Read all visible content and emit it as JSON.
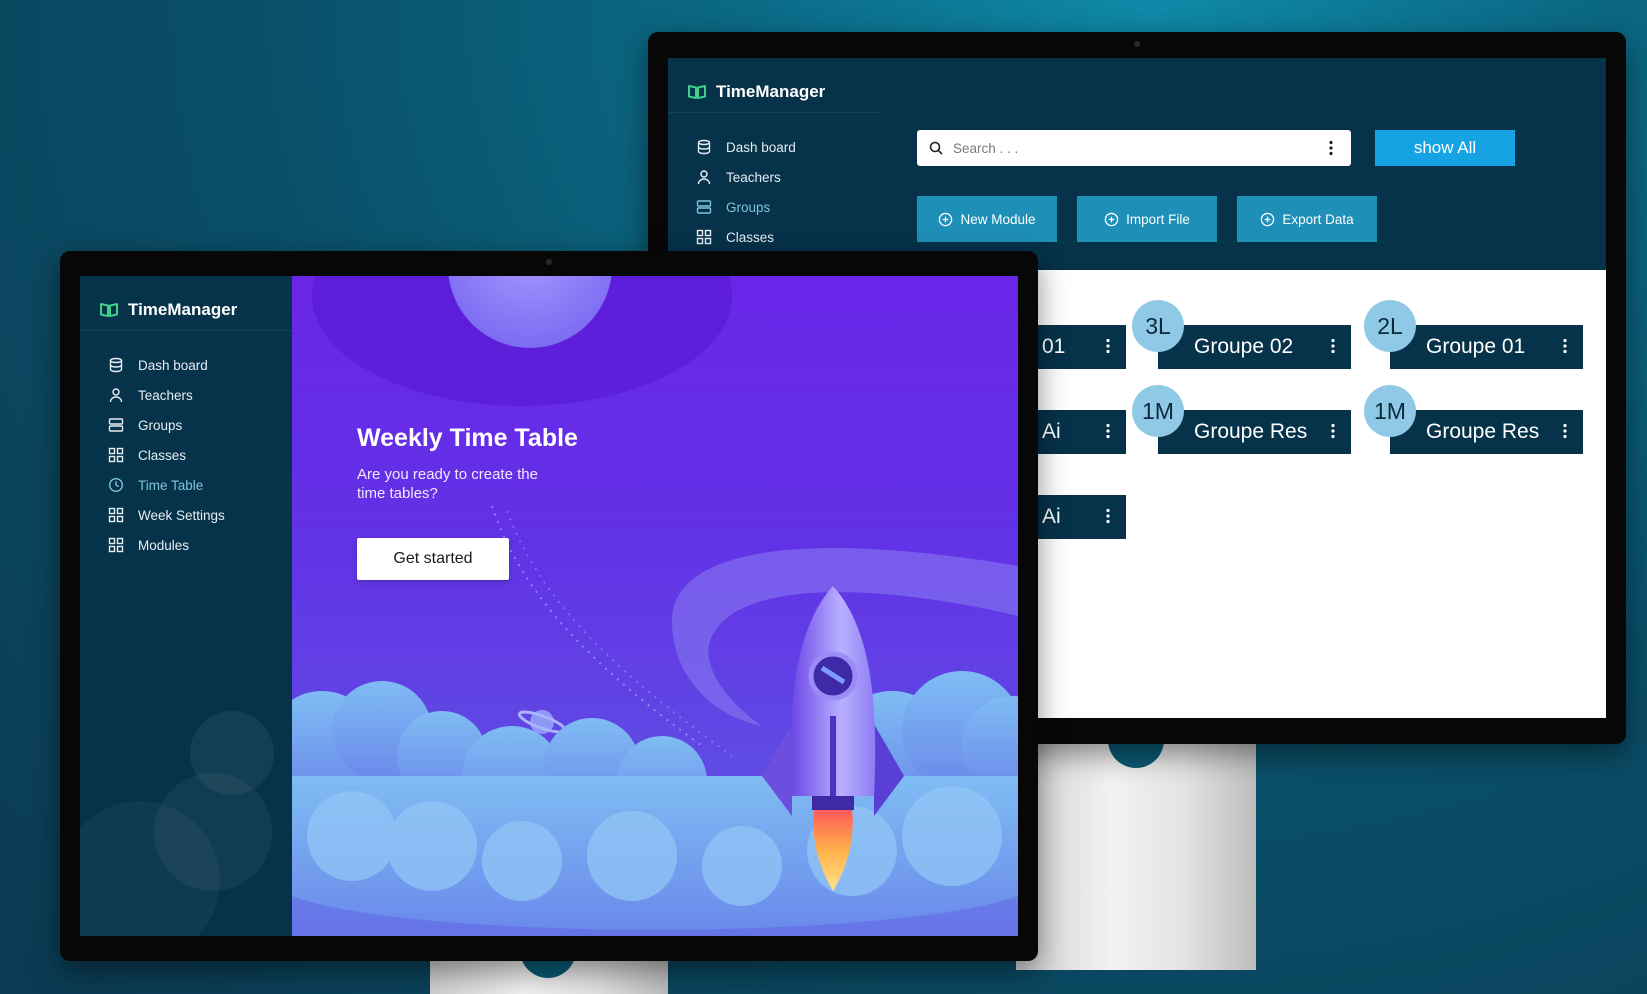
{
  "app": {
    "name": "TimeManager"
  },
  "sidebar_back": {
    "items": [
      {
        "label": "Dash board",
        "icon": "database-icon",
        "active": false
      },
      {
        "label": "Teachers",
        "icon": "user-icon",
        "active": false
      },
      {
        "label": "Groups",
        "icon": "server-icon",
        "active": true
      },
      {
        "label": "Classes",
        "icon": "grid-icon",
        "active": false
      }
    ]
  },
  "sidebar_front": {
    "items": [
      {
        "label": "Dash board",
        "icon": "database-icon",
        "active": false
      },
      {
        "label": "Teachers",
        "icon": "user-icon",
        "active": false
      },
      {
        "label": "Groups",
        "icon": "server-icon",
        "active": false
      },
      {
        "label": "Classes",
        "icon": "grid-icon",
        "active": false
      },
      {
        "label": "Time Table",
        "icon": "clock-icon",
        "active": true
      },
      {
        "label": "Week Settings",
        "icon": "grid-icon",
        "active": false
      },
      {
        "label": "Modules",
        "icon": "grid-icon",
        "active": false
      }
    ]
  },
  "groups_page": {
    "search": {
      "placeholder": "Search . . ."
    },
    "show_all_label": "show All",
    "actions": [
      {
        "label": "New Module",
        "icon": "plus-circle-icon"
      },
      {
        "label": "Import File",
        "icon": "plus-circle-icon"
      },
      {
        "label": "Export Data",
        "icon": "plus-circle-icon"
      }
    ],
    "cards": [
      {
        "label": "01",
        "badge": ""
      },
      {
        "label": "Groupe 02",
        "badge": "3L"
      },
      {
        "label": "Groupe 01",
        "badge": "2L"
      },
      {
        "label": "Ai",
        "badge": ""
      },
      {
        "label": "Groupe Res",
        "badge": "1M"
      },
      {
        "label": "Groupe Res",
        "badge": "1M"
      },
      {
        "label": "Ai",
        "badge": ""
      }
    ]
  },
  "timetable_page": {
    "title": "Weekly Time Table",
    "subtitle": "Are you ready to create the time tables?",
    "cta_label": "Get started"
  },
  "colors": {
    "sidebar_bg": "#06324a",
    "accent_blue": "#16a3e3",
    "action_button": "#1e8fb7",
    "active_nav": "#7fc4dd",
    "brand_green": "#3fd18b",
    "hero_purple": "#6a25e8",
    "badge": "#8fc9e6"
  }
}
